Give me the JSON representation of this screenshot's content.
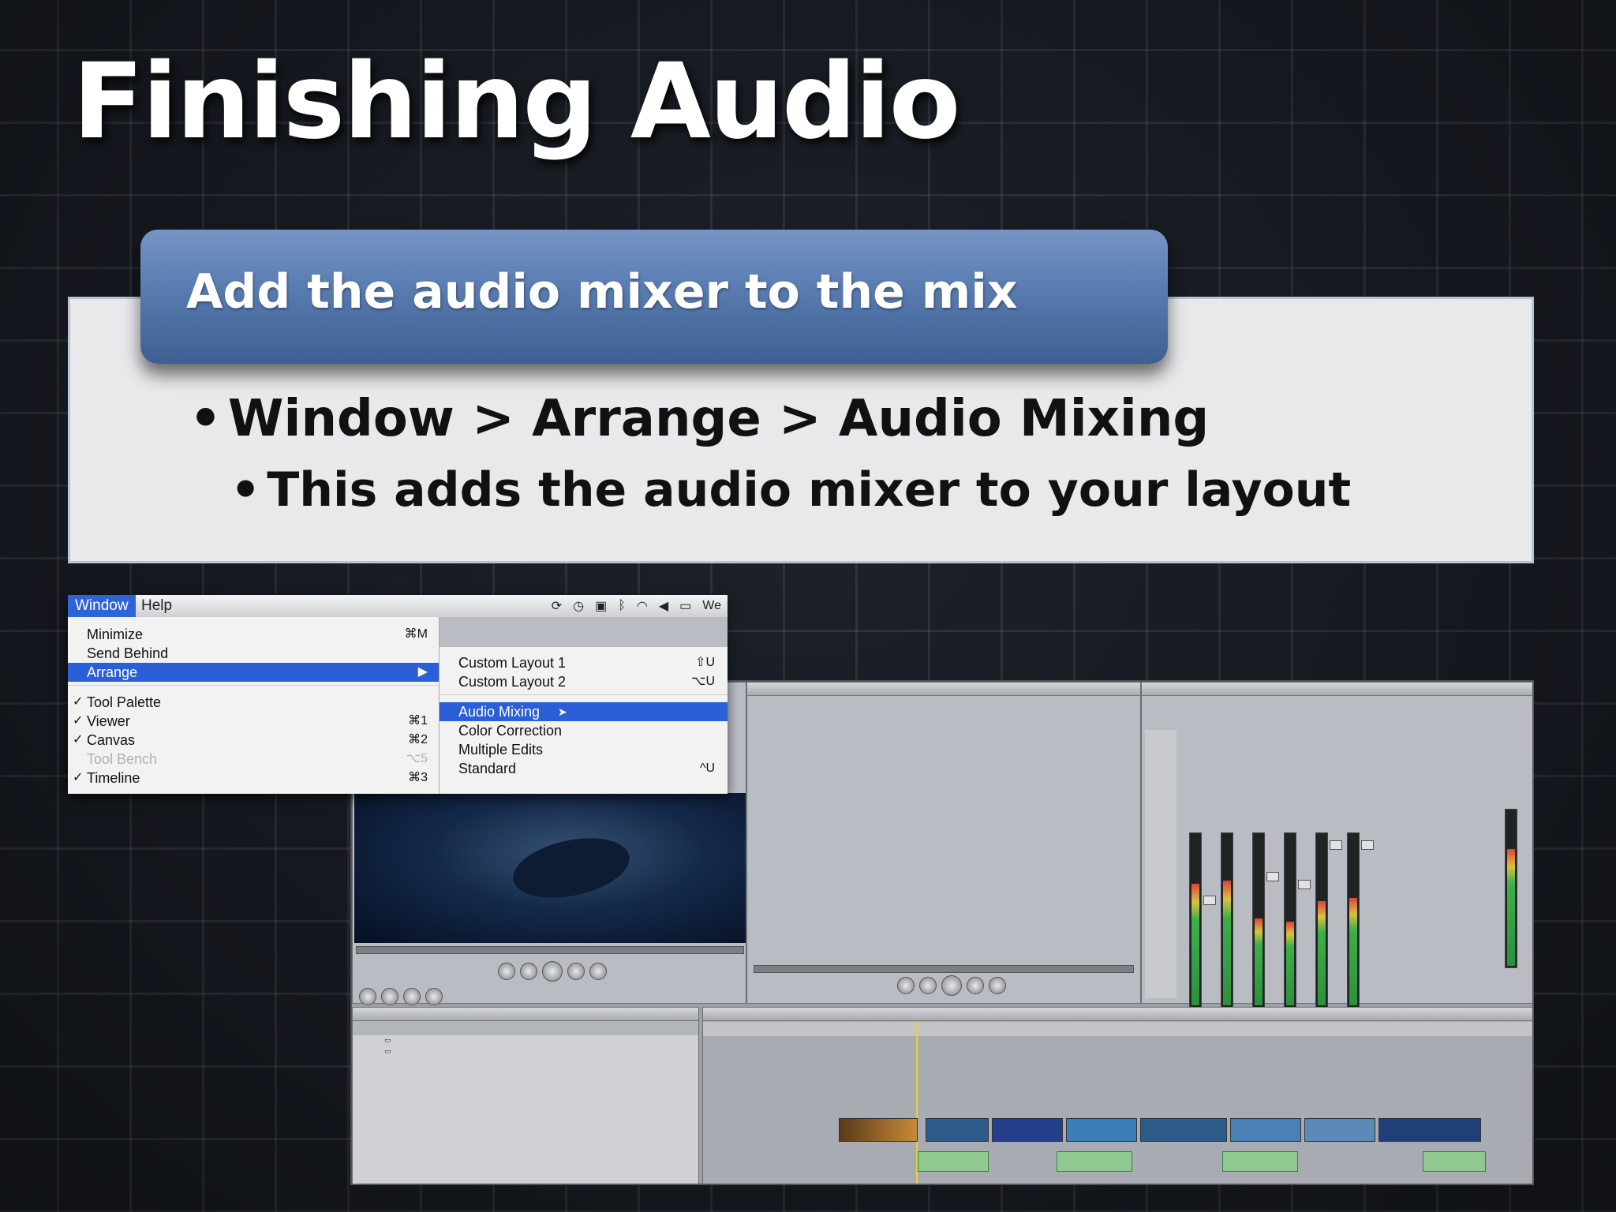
{
  "slide": {
    "title": "Finishing Audio",
    "header": "Add the audio mixer to the mix",
    "bullets": [
      "Window > Arrange > Audio Mixing",
      "This adds the audio mixer to your layout"
    ],
    "bullet_glyph": "•"
  },
  "menubar": {
    "items": [
      "Window",
      "Help"
    ],
    "status_icons": [
      "sync-icon",
      "clock-icon",
      "display-icon",
      "bluetooth-icon",
      "wifi-icon",
      "volume-icon",
      "battery-icon"
    ],
    "right_text": "We"
  },
  "window_menu": {
    "items": [
      {
        "label": "Minimize",
        "shortcut": "⌘M",
        "checked": false
      },
      {
        "label": "Send Behind",
        "shortcut": "",
        "checked": false
      },
      {
        "label": "Arrange",
        "shortcut": "▶",
        "checked": false
      },
      {
        "label": "Tool Palette",
        "shortcut": "",
        "checked": true
      },
      {
        "label": "Viewer",
        "shortcut": "⌘1",
        "checked": true
      },
      {
        "label": "Canvas",
        "shortcut": "⌘2",
        "checked": true
      },
      {
        "label": "Tool Bench",
        "shortcut": "⌥5",
        "checked": false
      },
      {
        "label": "Timeline",
        "shortcut": "⌘3",
        "checked": true
      }
    ],
    "check_glyph": "✓"
  },
  "arrange_submenu": {
    "items": [
      {
        "label": "Custom Layout 1",
        "shortcut": "⇧U"
      },
      {
        "label": "Custom Layout 2",
        "shortcut": "⌥U"
      },
      {
        "label": "Audio Mixing",
        "shortcut": ""
      },
      {
        "label": "Color Correction",
        "shortcut": ""
      },
      {
        "label": "Multiple Edits",
        "shortcut": ""
      },
      {
        "label": "Standard",
        "shortcut": "^U"
      }
    ]
  },
  "colors": {
    "header_blue": "#587bb0",
    "menu_highlight": "#2a5fd8",
    "panel_bg": "#e9e9ec",
    "canvas_border": "#37a7a0"
  }
}
